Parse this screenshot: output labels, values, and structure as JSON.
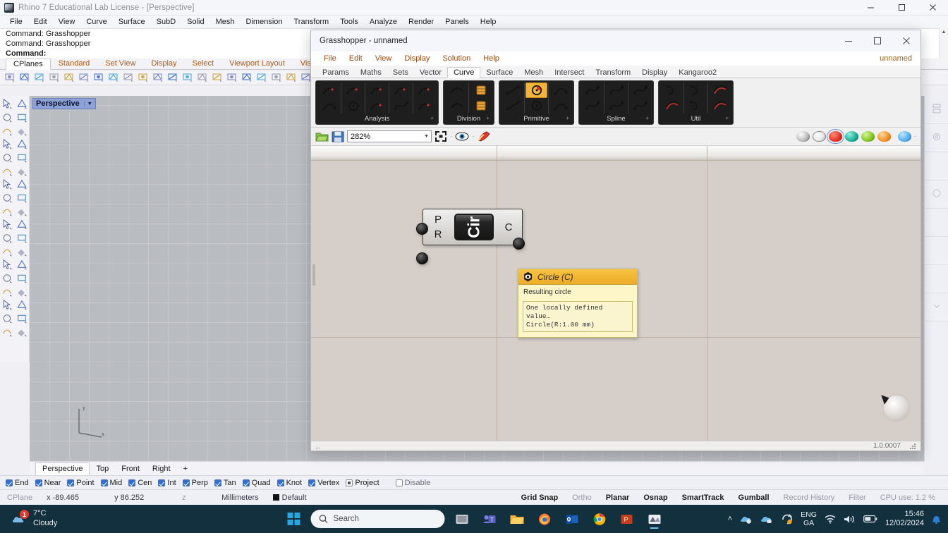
{
  "rhino": {
    "title": "Rhino 7 Educational Lab License - [Perspective]",
    "app_icon": "rhino-icon",
    "menus": [
      "File",
      "Edit",
      "View",
      "Curve",
      "Surface",
      "SubD",
      "Solid",
      "Mesh",
      "Dimension",
      "Transform",
      "Tools",
      "Analyze",
      "Render",
      "Panels",
      "Help"
    ],
    "command_history": [
      "Command: Grasshopper",
      "Command: Grasshopper"
    ],
    "command_prompt": "Command:",
    "toolbar_tabs": [
      "CPlanes",
      "Standard",
      "Set View",
      "Display",
      "Select",
      "Viewport Layout",
      "Visibility"
    ],
    "active_toolbar_tab": "CPlanes",
    "viewport": {
      "label": "Perspective",
      "axis_x_label": "x",
      "axis_y_label": "y"
    },
    "viewport_tabs": [
      "Perspective",
      "Top",
      "Front",
      "Right"
    ],
    "viewport_tab_add": "+",
    "active_viewport_tab": "Perspective",
    "osnap": [
      {
        "label": "End",
        "state": "checked"
      },
      {
        "label": "Near",
        "state": "checked"
      },
      {
        "label": "Point",
        "state": "checked"
      },
      {
        "label": "Mid",
        "state": "checked"
      },
      {
        "label": "Cen",
        "state": "checked"
      },
      {
        "label": "Int",
        "state": "checked"
      },
      {
        "label": "Perp",
        "state": "checked"
      },
      {
        "label": "Tan",
        "state": "checked"
      },
      {
        "label": "Quad",
        "state": "checked"
      },
      {
        "label": "Knot",
        "state": "checked"
      },
      {
        "label": "Vertex",
        "state": "checked"
      },
      {
        "label": "Project",
        "state": "square"
      },
      {
        "label": "Disable",
        "state": "unchecked"
      }
    ],
    "status": {
      "cplane": "CPlane",
      "x": "x -89.465",
      "y": "y 86.252",
      "z": "z",
      "units": "Millimeters",
      "layer": "Default",
      "toggles": [
        {
          "label": "Grid Snap",
          "on": true
        },
        {
          "label": "Ortho",
          "on": false
        },
        {
          "label": "Planar",
          "on": true
        },
        {
          "label": "Osnap",
          "on": true
        },
        {
          "label": "SmartTrack",
          "on": true
        },
        {
          "label": "Gumball",
          "on": true
        },
        {
          "label": "Record History",
          "on": false
        },
        {
          "label": "Filter",
          "on": false
        }
      ],
      "cpu": "CPU use: 1.2 %"
    }
  },
  "grasshopper": {
    "title": "Grasshopper - unnamed",
    "window_buttons": [
      "minimize",
      "maximize",
      "close"
    ],
    "menus": [
      "File",
      "Edit",
      "View",
      "Display",
      "Solution",
      "Help"
    ],
    "document_name": "unnamed",
    "tabs": [
      "Params",
      "Maths",
      "Sets",
      "Vector",
      "Curve",
      "Surface",
      "Mesh",
      "Intersect",
      "Transform",
      "Display",
      "Kangaroo2"
    ],
    "active_tab": "Curve",
    "ribbon_groups": [
      {
        "name": "Analysis",
        "expand": "+",
        "icons": [
          "curve-closed-icon",
          "curve-endpoints-icon",
          "curve-discontinuity-icon",
          "curve-evaluate-icon",
          "curve-middle-icon",
          "curve-arc-icon",
          "polygon-center-icon",
          "curve-side-icon",
          "curve-tangent-icon",
          "curve-deviation-icon"
        ]
      },
      {
        "name": "Division",
        "expand": "+",
        "icons": [
          "divide-curve-icon",
          "shatter-icon",
          "dash-pattern-icon",
          "contour-icon"
        ]
      },
      {
        "name": "Primitive",
        "expand": "+",
        "icons": [
          "line-icon",
          "circle-icon",
          "arc-icon",
          "line-sdl-icon",
          "circle-3pt-icon",
          "arc-3pt-icon"
        ],
        "selected_icon": "circle-icon"
      },
      {
        "name": "Spline",
        "expand": "+",
        "icons": [
          "interpolate-icon",
          "nurbs-curve-icon",
          "bezier-span-icon",
          "tangent-curve-icon",
          "kinky-curve-icon",
          "curve-on-surface-icon"
        ]
      },
      {
        "name": "Util",
        "expand": "+",
        "icons": [
          "join-curves-icon",
          "flip-curve-icon",
          "offset-curve-icon",
          "fillet-icon",
          "explode-icon",
          "blend-curve-icon"
        ]
      }
    ],
    "canvas_toolbar": {
      "open_icon": "open-folder-icon",
      "save_icon": "save-icon",
      "zoom_value": "282%",
      "zoom_dropdown": "chevron-down-icon",
      "zoom_extents_icon": "zoom-extents-icon",
      "preview_icon": "eye-preview-icon",
      "bake_icon": "bake-icon",
      "right_icons": [
        "preview-off-icon",
        "preview-wireframe-icon",
        "preview-shaded-icon",
        "preview-mesh-icon",
        "preview-green-icon",
        "preview-orange-icon",
        "preview-blue-icon"
      ],
      "active_right_icon": "preview-shaded-icon"
    },
    "component": {
      "nickname": "Cir",
      "inputs": [
        {
          "label": "P",
          "name": "plane-input"
        },
        {
          "label": "R",
          "name": "radius-input"
        }
      ],
      "outputs": [
        {
          "label": "C",
          "name": "circle-output"
        }
      ]
    },
    "tooltip": {
      "icon": "circle-param-icon",
      "title": "Circle (C)",
      "description": "Resulting circle",
      "data_lines": [
        "One locally defined value…",
        "Circle(R:1.00 mm)"
      ]
    },
    "statusbar": {
      "left_glyph": "...",
      "version": "1.0.0007",
      "resize_grip": "resize-grip-icon"
    },
    "nav_ball": "navigation-ball-icon"
  },
  "taskbar": {
    "weather": {
      "temp": "7°C",
      "condition": "Cloudy",
      "badge": "1",
      "icon": "cloud-icon"
    },
    "start_icon": "windows-start-icon",
    "search_placeholder": "Search",
    "search_icon": "search-icon",
    "apps": [
      {
        "name": "task-view",
        "icon": "task-view-icon"
      },
      {
        "name": "microsoft-teams",
        "icon": "teams-icon"
      },
      {
        "name": "file-explorer",
        "icon": "folder-icon"
      },
      {
        "name": "firefox",
        "icon": "firefox-icon"
      },
      {
        "name": "outlook",
        "icon": "outlook-icon"
      },
      {
        "name": "chrome",
        "icon": "chrome-icon"
      },
      {
        "name": "powerpoint",
        "icon": "powerpoint-icon"
      },
      {
        "name": "rhino",
        "icon": "rhino-taskbar-icon",
        "active": true
      }
    ],
    "tray": {
      "overflow_icon": "chevron-up-icon",
      "icons": [
        "onedrive-icon",
        "onedrive-work-icon",
        "update-icon"
      ],
      "language": {
        "line1": "ENG",
        "line2": "GA"
      },
      "wifi_icon": "wifi-icon",
      "volume_icon": "speaker-icon",
      "battery_icon": "battery-icon",
      "time": "15:46",
      "date": "12/02/2024",
      "notification_icon": "bell-icon"
    }
  }
}
